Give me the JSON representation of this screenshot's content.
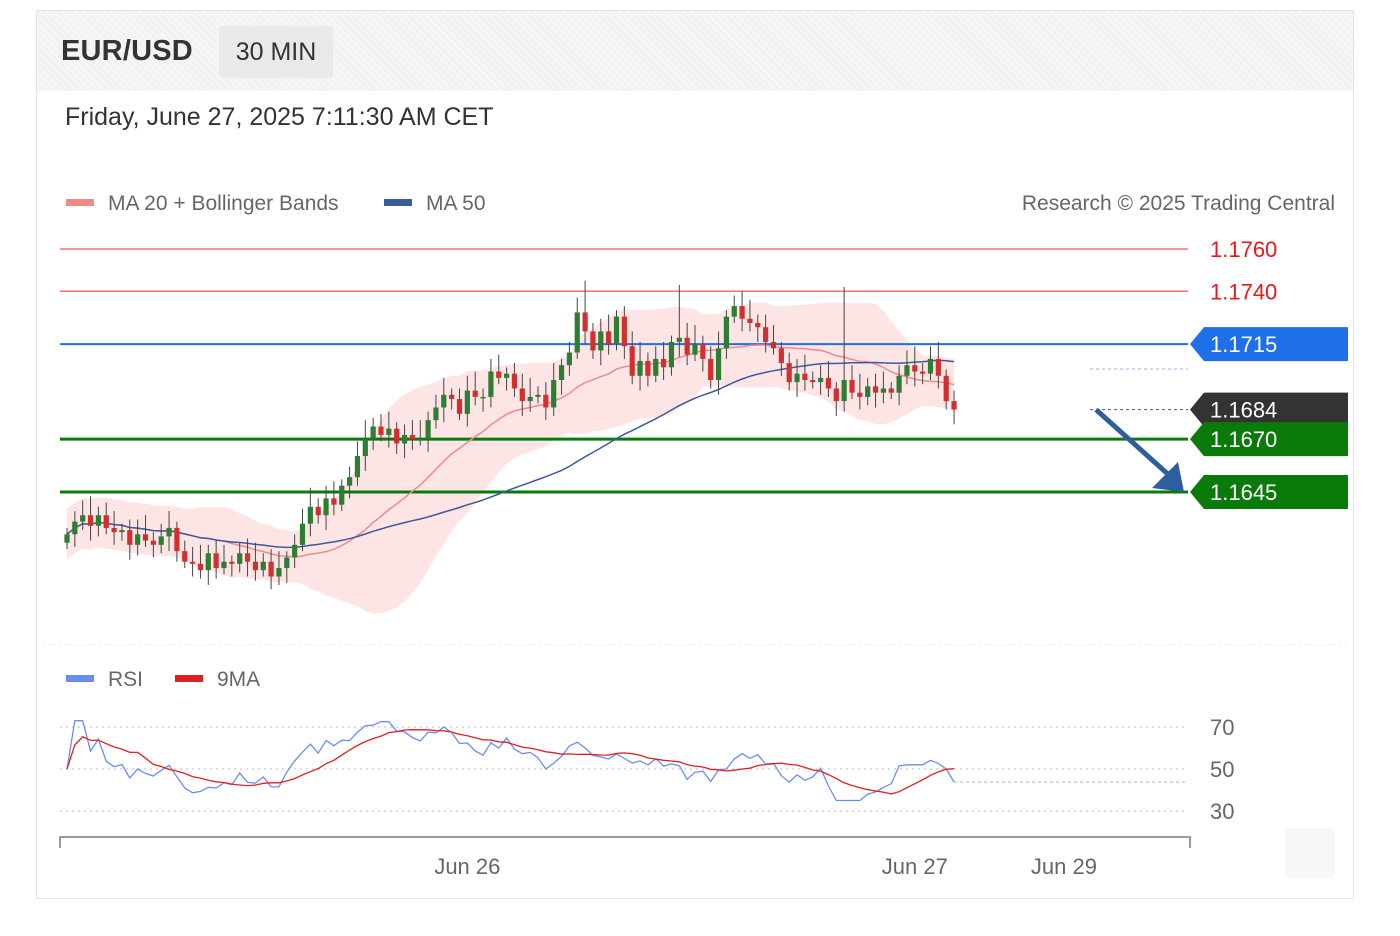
{
  "header": {
    "symbol": "EUR/USD",
    "timeframe": "30 MIN"
  },
  "timestamp": "Friday, June 27, 2025 7:11:30 AM CET",
  "legend": {
    "ma20": "MA 20 + Bollinger Bands",
    "ma50": "MA 50",
    "rsi": "RSI",
    "ma9": "9MA",
    "credit": "Research © 2025 Trading Central"
  },
  "colors": {
    "resistance": "#f07070",
    "pivot": "#1f6fe8",
    "support": "#0a7a0a",
    "current": "#333333",
    "ma20": "#f08a8a",
    "ma50": "#3b5b9a",
    "bollinger": "#fde0e0",
    "bull": "#2e7d32",
    "bear": "#d32f2f",
    "rsi": "#6a8df0",
    "rsi_ma": "#e02020",
    "arrow": "#2f5e9e"
  },
  "chart_data": [
    {
      "type": "candlestick",
      "title": "EUR/USD",
      "ylim": [
        1.159,
        1.177
      ],
      "price_levels": [
        {
          "label": "1.1760",
          "value": 1.176,
          "kind": "resistance"
        },
        {
          "label": "1.1740",
          "value": 1.174,
          "kind": "resistance"
        },
        {
          "label": "1.1715",
          "value": 1.1715,
          "kind": "pivot"
        },
        {
          "label": "1.1684",
          "value": 1.1684,
          "kind": "current"
        },
        {
          "label": "1.1670",
          "value": 1.167,
          "kind": "support"
        },
        {
          "label": "1.1645",
          "value": 1.1645,
          "kind": "support"
        }
      ],
      "x_ticks": [
        {
          "label": "Jun 26",
          "index": 51
        },
        {
          "label": "Jun 27",
          "index": 108
        },
        {
          "label": "Jun 29",
          "index": 127
        }
      ],
      "close": [
        1.1625,
        1.1631,
        1.1634,
        1.1629,
        1.1634,
        1.1628,
        1.1626,
        1.1627,
        1.162,
        1.1625,
        1.1622,
        1.162,
        1.1624,
        1.1628,
        1.1617,
        1.1612,
        1.1611,
        1.1608,
        1.1616,
        1.1609,
        1.1612,
        1.1611,
        1.1616,
        1.1612,
        1.1608,
        1.1612,
        1.1605,
        1.1609,
        1.1614,
        1.162,
        1.163,
        1.1638,
        1.1634,
        1.1642,
        1.1639,
        1.1648,
        1.1652,
        1.1662,
        1.167,
        1.1676,
        1.1672,
        1.1675,
        1.1668,
        1.1672,
        1.167,
        1.167,
        1.1679,
        1.1685,
        1.1691,
        1.1689,
        1.1682,
        1.1693,
        1.169,
        1.169,
        1.1702,
        1.1699,
        1.1701,
        1.1694,
        1.1688,
        1.169,
        1.1691,
        1.1685,
        1.1698,
        1.1705,
        1.1711,
        1.173,
        1.1721,
        1.1712,
        1.1721,
        1.1715,
        1.1728,
        1.1714,
        1.17,
        1.1707,
        1.17,
        1.1708,
        1.1704,
        1.1716,
        1.1718,
        1.171,
        1.1715,
        1.1708,
        1.1698,
        1.1713,
        1.1728,
        1.1733,
        1.1727,
        1.1725,
        1.1723,
        1.1716,
        1.1713,
        1.1706,
        1.1697,
        1.1701,
        1.1698,
        1.1697,
        1.1699,
        1.1694,
        1.1688,
        1.1698,
        1.1692,
        1.169,
        1.1695,
        1.1692,
        1.1694,
        1.1692,
        1.17,
        1.1705,
        1.1702,
        1.1701,
        1.1708,
        1.17,
        1.1688,
        1.1684
      ],
      "series": [
        {
          "name": "MA 20 + Bollinger Bands",
          "kind": "ma20"
        },
        {
          "name": "MA 50",
          "kind": "ma50"
        }
      ],
      "forecast_arrow": {
        "from": 1.1684,
        "to": 1.1645
      }
    },
    {
      "type": "line",
      "title": "RSI",
      "ylim": [
        20,
        80
      ],
      "y_ticks": [
        {
          "label": "70",
          "value": 70
        },
        {
          "label": "50",
          "value": 50
        },
        {
          "label": "30",
          "value": 30
        }
      ],
      "series": [
        {
          "name": "RSI",
          "kind": "rsi"
        },
        {
          "name": "9MA",
          "kind": "rsi_ma"
        }
      ]
    }
  ]
}
